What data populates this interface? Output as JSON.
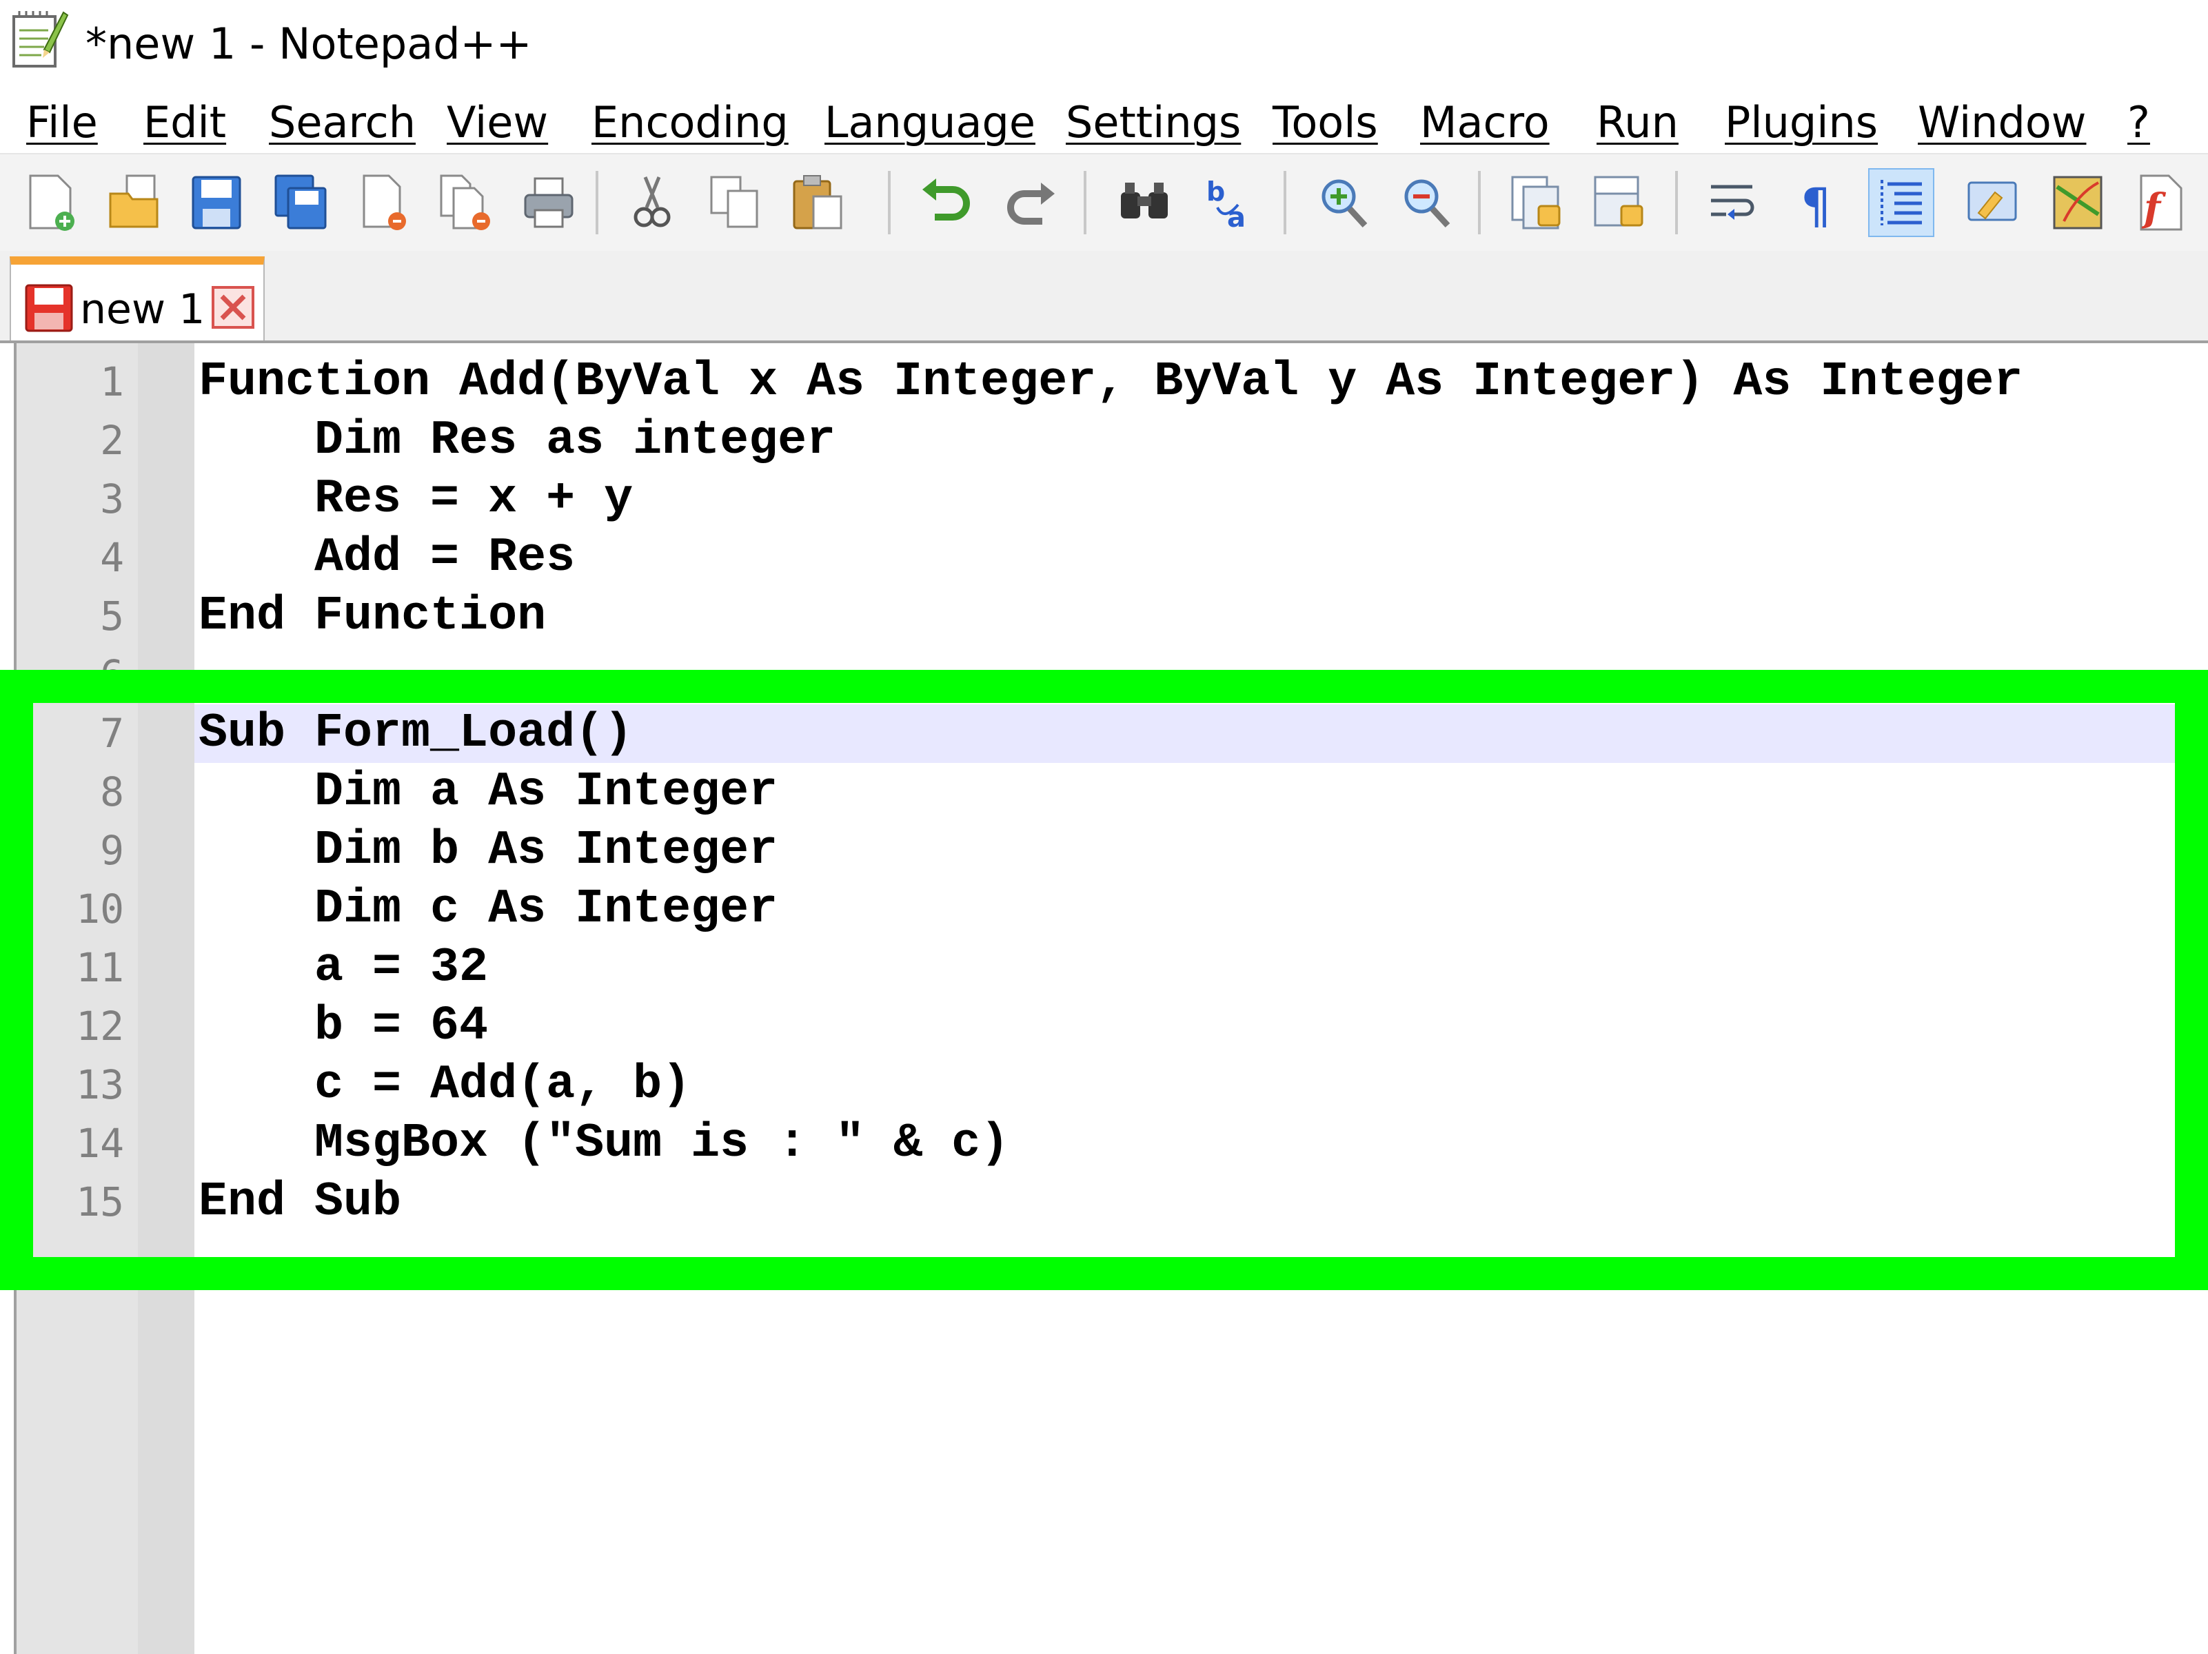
{
  "window": {
    "title": "*new 1 - Notepad++"
  },
  "menu": {
    "items": [
      "File",
      "Edit",
      "Search",
      "View",
      "Encoding",
      "Language",
      "Settings",
      "Tools",
      "Macro",
      "Run",
      "Plugins",
      "Window",
      "?"
    ]
  },
  "toolbar": {
    "buttons": [
      "new-file-icon",
      "open-file-icon",
      "save-icon",
      "save-all-icon",
      "close-icon",
      "close-all-icon",
      "print-icon",
      "cut-icon",
      "copy-icon",
      "paste-icon",
      "undo-icon",
      "redo-icon",
      "find-icon",
      "replace-icon",
      "zoom-in-icon",
      "zoom-out-icon",
      "sync-vertical-icon",
      "sync-horizontal-icon",
      "word-wrap-icon",
      "show-all-characters-icon",
      "indent-guide-icon",
      "user-defined-language-icon",
      "document-map-icon",
      "function-list-icon"
    ],
    "active": "indent-guide-icon"
  },
  "tabs": [
    {
      "label": "new 1",
      "unsaved": true,
      "active": true
    }
  ],
  "editor": {
    "current_line": 7,
    "lines": [
      {
        "n": "1",
        "text": "Function Add(ByVal x As Integer, ByVal y As Integer) As Integer"
      },
      {
        "n": "2",
        "text": "    Dim Res as integer"
      },
      {
        "n": "3",
        "text": "    Res = x + y"
      },
      {
        "n": "4",
        "text": "    Add = Res"
      },
      {
        "n": "5",
        "text": "End Function"
      },
      {
        "n": "6",
        "text": ""
      },
      {
        "n": "7",
        "text": "Sub Form_Load()"
      },
      {
        "n": "8",
        "text": "    Dim a As Integer"
      },
      {
        "n": "9",
        "text": "    Dim b As Integer"
      },
      {
        "n": "10",
        "text": "    Dim c As Integer"
      },
      {
        "n": "11",
        "text": "    a = 32"
      },
      {
        "n": "12",
        "text": "    b = 64"
      },
      {
        "n": "13",
        "text": "    c = Add(a, b)"
      },
      {
        "n": "14",
        "text": "    MsgBox (\"Sum is : \" & c)"
      },
      {
        "n": "15",
        "text": "End Sub"
      }
    ]
  },
  "colors": {
    "highlight_border": "#00ff00",
    "current_line": "#e8e8ff",
    "tab_accent": "#f6a336"
  }
}
